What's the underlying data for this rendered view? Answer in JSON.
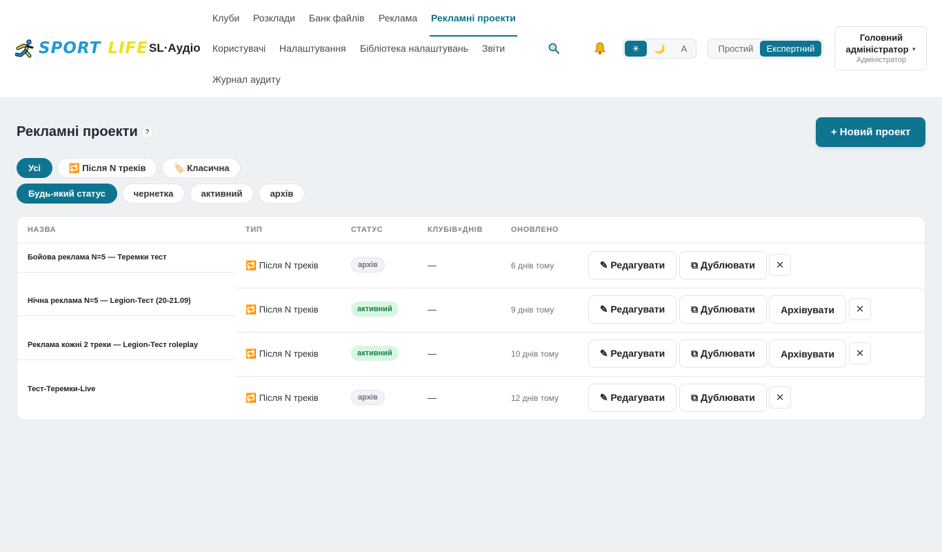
{
  "brand": {
    "logo_word_1": "SPORT",
    "logo_word_2": "LIFE",
    "app_name": "SL·Аудіо"
  },
  "nav": {
    "row1": [
      "Клуби",
      "Розклади",
      "Банк файлів",
      "Реклама",
      "Рекламні проекти"
    ],
    "row2": [
      "Користувачі",
      "Налаштування",
      "Бібліотека налаштувань",
      "Звіти"
    ],
    "row3": [
      "Журнал аудиту"
    ],
    "active": "Рекламні проекти"
  },
  "header_icons": {
    "search": "search-icon",
    "notifications": "bell-icon"
  },
  "theme": {
    "light": "☀",
    "dark": "🌙",
    "auto": "A",
    "selected": "light"
  },
  "mode": {
    "simple": "Простий",
    "expert": "Експертний",
    "selected": "expert"
  },
  "user": {
    "name_line1": "Головний",
    "name_line2": "адміністратор",
    "caret": "▾",
    "role": "Адміністратор"
  },
  "page": {
    "title": "Рекламні проекти",
    "help": "?",
    "new_button": "+ Новий проект"
  },
  "type_filters": {
    "all": "Усі",
    "after_n": "🔁 Після N треків",
    "classic": "🏷️ Класична",
    "selected": "all"
  },
  "status_filters": {
    "any": "Будь-який статус",
    "draft": "чернетка",
    "active": "активний",
    "archive": "архів",
    "selected": "any"
  },
  "table": {
    "headers": {
      "name": "НАЗВА",
      "type": "ТИП",
      "status": "СТАТУС",
      "clubs_days": "КЛУБІВ×ДНІВ",
      "updated": "ОНОВЛЕНО"
    },
    "rows": [
      {
        "name": "Бойова реклама N=5 — Теремки тест",
        "type": "🔁 Після N треків",
        "status": "архів",
        "status_kind": "archived",
        "clubs_days": "—",
        "updated": "6 днів тому",
        "edit": "✎ Редагувати",
        "duplicate": "⧉ Дублювати",
        "archive": "",
        "delete": "✕"
      },
      {
        "name": "Нічна реклама N=5 — Legion-Тест (20-21.09)",
        "type": "🔁 Після N треків",
        "status": "активний",
        "status_kind": "active",
        "clubs_days": "—",
        "updated": "9 днів тому",
        "edit": "✎ Редагувати",
        "duplicate": "⧉ Дублювати",
        "archive": "Архівувати",
        "delete": "✕"
      },
      {
        "name": "Реклама кожні 2 треки — Legion-Тест roleplay",
        "type": "🔁 Після N треків",
        "status": "активний",
        "status_kind": "active",
        "clubs_days": "—",
        "updated": "10 днів тому",
        "edit": "✎ Редагувати",
        "duplicate": "⧉ Дублювати",
        "archive": "Архівувати",
        "delete": "✕"
      },
      {
        "name": "Тест-Теремки-Live",
        "type": "🔁 Після N треків",
        "status": "архів",
        "status_kind": "archived",
        "clubs_days": "—",
        "updated": "12 днів тому",
        "edit": "✎ Редагувати",
        "duplicate": "⧉ Дублювати",
        "archive": "",
        "delete": "✕"
      }
    ]
  },
  "colors": {
    "accent": "#0e7490",
    "logo_blue": "#1f9ad6",
    "logo_yellow": "#f2df1a",
    "active_badge_bg": "#d9f6e4",
    "active_badge_text": "#15803d"
  }
}
